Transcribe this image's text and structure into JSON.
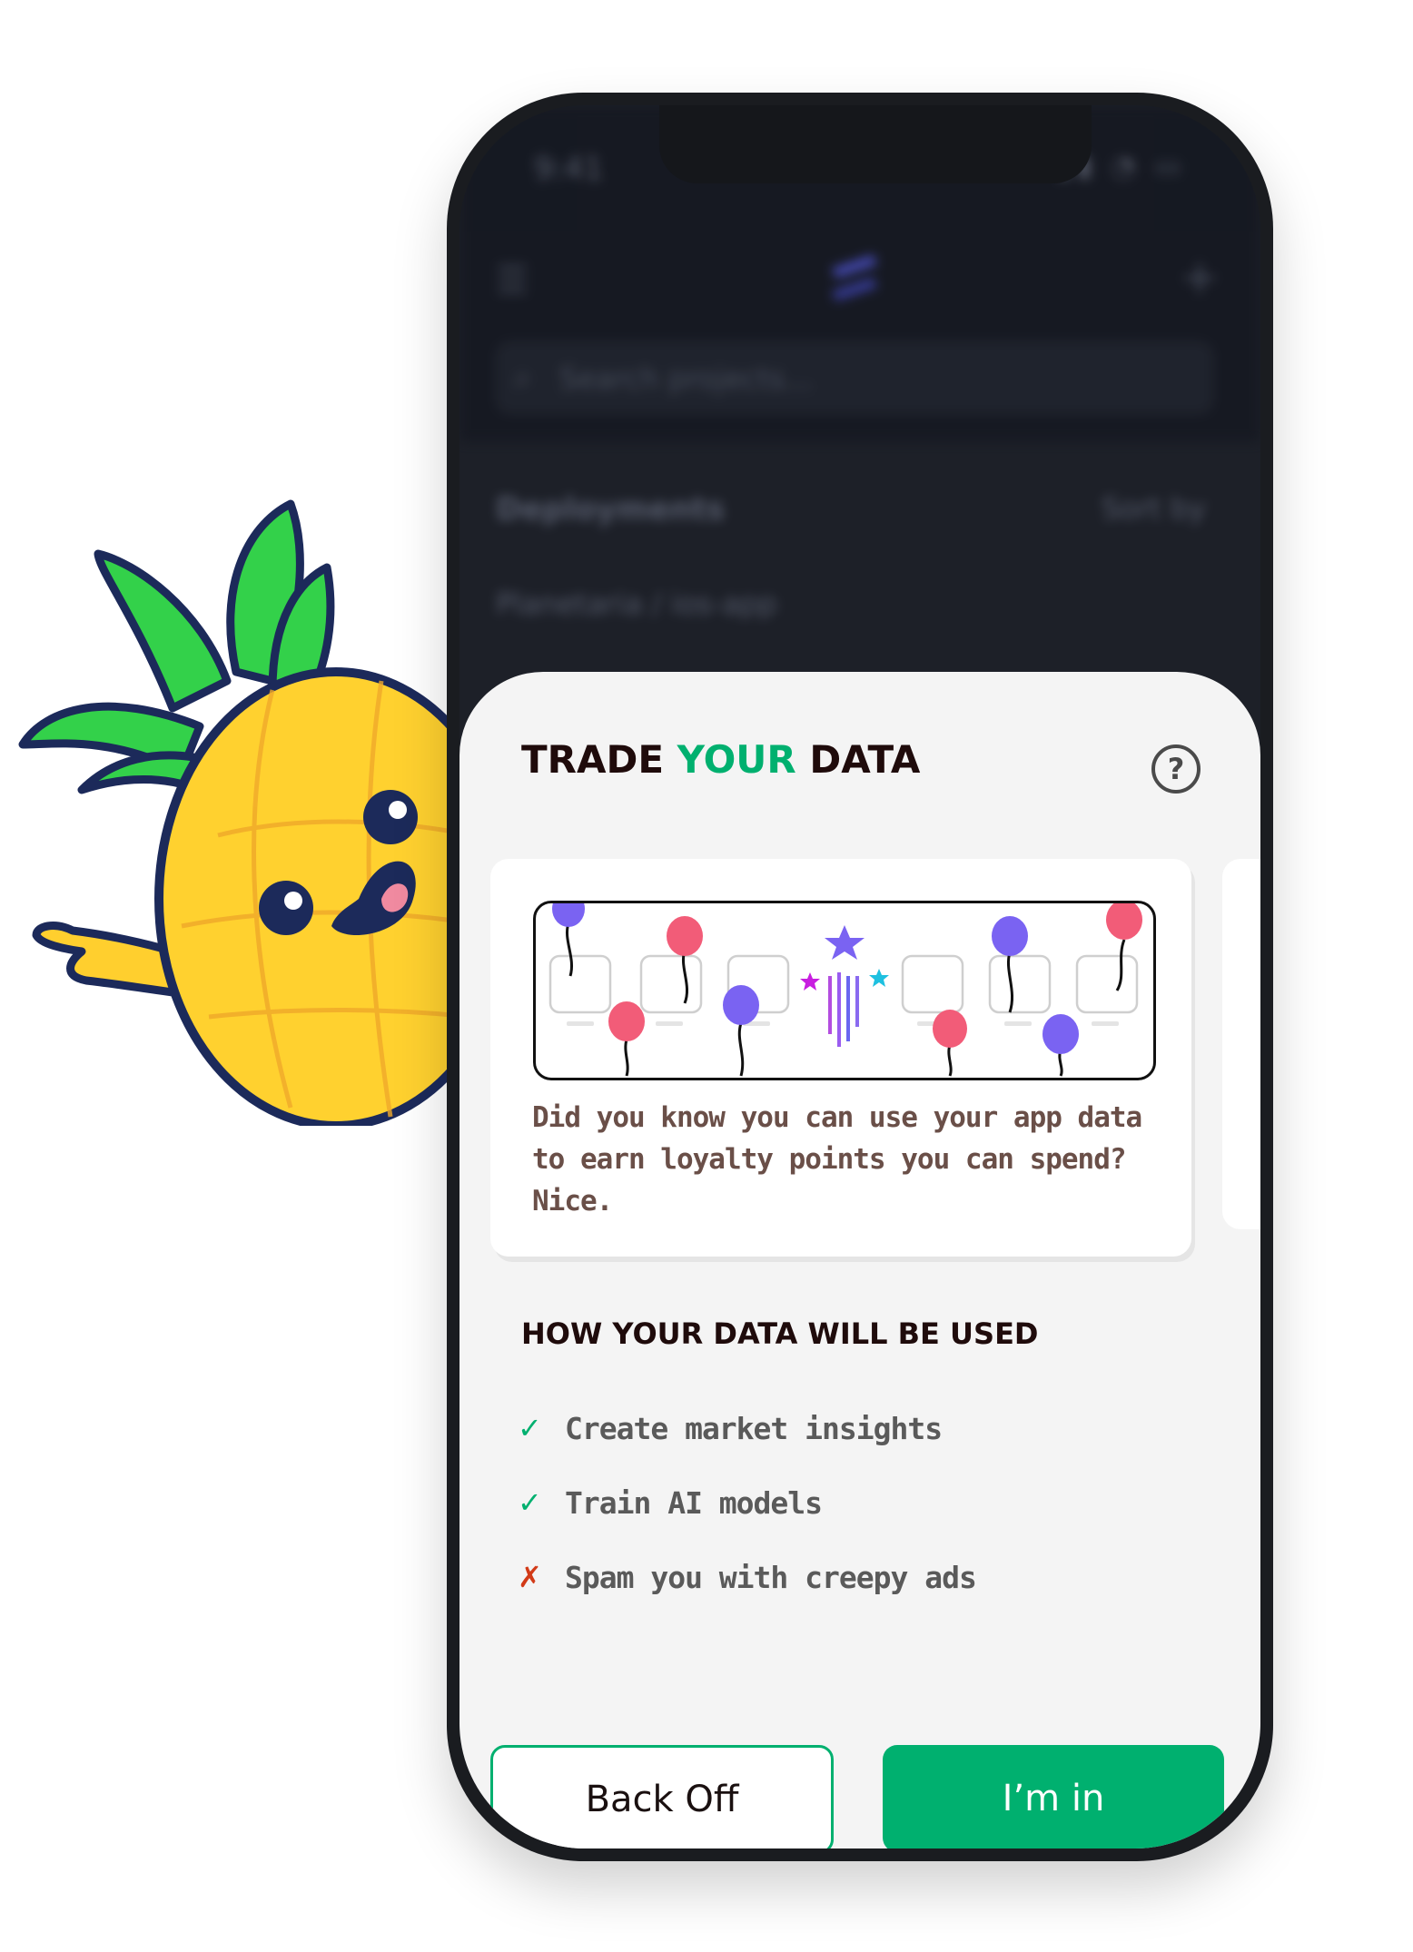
{
  "background_app": {
    "status_time": "9:41",
    "status_icons": "▮▮ ◔ ▭",
    "search_placeholder": "Search projects...",
    "section_title": "Deployments",
    "sort_label": "Sort by",
    "row_label": "Planetaria / ios-app"
  },
  "sheet": {
    "title_part1": "TRADE ",
    "title_highlight": "YOUR",
    "title_part2": " DATA",
    "help_label": "?",
    "card_text": "Did you know you can use your app data to earn loyalty points you can spend? Nice.",
    "usage_title": "HOW YOUR DATA WILL BE USED",
    "usage_items": [
      {
        "mark": "✓",
        "text": "Create market insights",
        "allowed": true
      },
      {
        "mark": "✓",
        "text": "Train AI models",
        "allowed": true
      },
      {
        "mark": "✗",
        "text": "Spam you with creepy ads",
        "allowed": false
      }
    ],
    "back_button": "Back Off",
    "accept_button": "I’m in"
  },
  "colors": {
    "accent": "#00b06f",
    "deny": "#d23a17",
    "title": "#1f0b0b",
    "sheet_bg": "#f4f4f4",
    "phone_frame": "#1a1c20"
  },
  "icons": [
    "help-icon",
    "check-icon",
    "cross-icon",
    "pineapple-mascot",
    "balloon-icon",
    "star-icon"
  ]
}
